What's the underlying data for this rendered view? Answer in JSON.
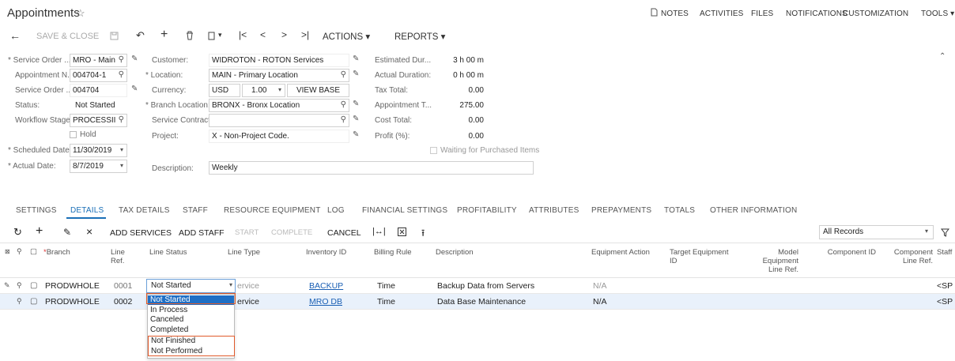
{
  "header": {
    "title": "Appointments",
    "links": [
      "NOTES",
      "ACTIVITIES",
      "FILES",
      "NOTIFICATIONS",
      "CUSTOMIZATION",
      "TOOLS"
    ]
  },
  "toolbar": {
    "save_close": "SAVE & CLOSE",
    "actions": "ACTIONS",
    "reports": "REPORTS"
  },
  "form": {
    "service_order_type_label": "Service Order ...",
    "service_order_type": "MRO - Main",
    "appointment_nbr_label": "Appointment N...",
    "appointment_nbr": "004704-1",
    "service_order_nbr_label": "Service Order ...",
    "service_order_nbr": "004704",
    "status_label": "Status:",
    "status": "Not Started",
    "workflow_label": "Workflow Stage:",
    "workflow": "PROCESSII",
    "hold_label": "Hold",
    "scheduled_date_label": "Scheduled Date:",
    "scheduled_date": "11/30/2019",
    "actual_date_label": "Actual Date:",
    "actual_date": "8/7/2019",
    "customer_label": "Customer:",
    "customer": "WIDROTON - ROTON Services",
    "location_label": "Location:",
    "location": "MAIN - Primary Location",
    "currency_label": "Currency:",
    "currency": "USD",
    "rate": "1.00",
    "view_base": "VIEW BASE",
    "branch_location_label": "Branch Location:",
    "branch_location": "BRONX - Bronx Location",
    "service_contract_label": "Service Contract:",
    "service_contract": "",
    "project_label": "Project:",
    "project": "X - Non-Project Code.",
    "description_label": "Description:",
    "description": "Weekly",
    "est_duration_label": "Estimated Dur...",
    "est_duration": "3 h 00 m",
    "actual_duration_label": "Actual Duration:",
    "actual_duration": "0 h 00 m",
    "tax_total_label": "Tax Total:",
    "tax_total": "0.00",
    "appointment_total_label": "Appointment T...",
    "appointment_total": "275.00",
    "cost_total_label": "Cost Total:",
    "cost_total": "0.00",
    "profit_label": "Profit (%):",
    "profit": "0.00",
    "waiting_label": "Waiting for Purchased Items"
  },
  "tabs": [
    "SETTINGS",
    "DETAILS",
    "TAX DETAILS",
    "STAFF",
    "RESOURCE EQUIPMENT",
    "LOG",
    "FINANCIAL SETTINGS",
    "PROFITABILITY",
    "ATTRIBUTES",
    "PREPAYMENTS",
    "TOTALS",
    "OTHER INFORMATION"
  ],
  "grid_toolbar": {
    "add_services": "ADD SERVICES",
    "add_staff": "ADD STAFF",
    "start": "START",
    "complete": "COMPLETE",
    "cancel": "CANCEL",
    "filter_value": "All Records"
  },
  "columns": {
    "branch": "Branch",
    "line_ref": [
      "Line",
      "Ref."
    ],
    "line_status": "Line Status",
    "line_type": "Line Type",
    "inventory_id": "Inventory ID",
    "billing_rule": "Billing Rule",
    "description": "Description",
    "equipment_action": "Equipment Action",
    "target_equipment": [
      "Target Equipment",
      "ID"
    ],
    "model_equipment": [
      "Model",
      "Equipment",
      "Line Ref."
    ],
    "component_id": "Component ID",
    "component_line_ref": [
      "Component",
      "Line Ref."
    ],
    "staff": "Staff"
  },
  "rows": [
    {
      "branch": "PRODWHOLE",
      "line_ref": "0001",
      "line_status": "Not Started",
      "line_type": "ervice",
      "inventory_id": "BACKUP",
      "billing_rule": "Time",
      "description": "Backup Data from Servers",
      "equipment_action": "N/A",
      "staff": "<SP"
    },
    {
      "branch": "PRODWHOLE",
      "line_ref": "0002",
      "line_status": "",
      "line_type": "ervice",
      "inventory_id": "MRO DB",
      "billing_rule": "Time",
      "description": "Data Base Maintenance",
      "equipment_action": "N/A",
      "staff": "<SP"
    }
  ],
  "dropdown": {
    "options": [
      "Not Started",
      "In Process",
      "Canceled",
      "Completed",
      "Not Finished",
      "Not Performed"
    ],
    "selected": "Not Started",
    "highlight_color": "#e05a2b",
    "selected_color": "#1f6fc5"
  }
}
